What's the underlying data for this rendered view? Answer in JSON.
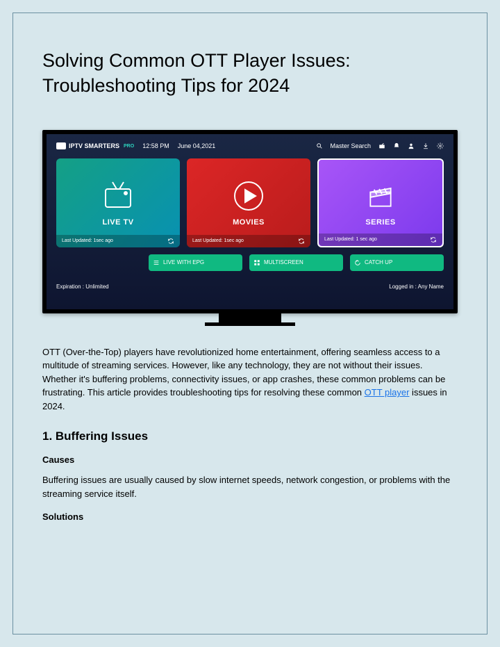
{
  "title": "Solving Common OTT Player Issues: Troubleshooting Tips for 2024",
  "tv": {
    "logo_main": "IPTV SMARTERS",
    "logo_sub": "PRO",
    "time": "12:58 PM",
    "date": "June 04,2021",
    "search_label": "Master Search",
    "tiles": {
      "livetv": {
        "label": "LIVE TV",
        "updated": "Last Updated: 1sec ago"
      },
      "movies": {
        "label": "MOVIES",
        "updated": "Last Updated: 1sec ago"
      },
      "series": {
        "label": "SERIES",
        "updated": "Last Updated: 1 sec ago"
      }
    },
    "buttons": {
      "live_epg": "LIVE WITH EPG",
      "multiscreen": "MULTISCREEN",
      "catchup": "CATCH UP"
    },
    "expiration": "Expiration : Unlimited",
    "logged_in": "Logged in : Any Name"
  },
  "intro": {
    "p1": "OTT (Over-the-Top) players have revolutionized home entertainment, offering seamless access to a multitude of streaming services. However, like any technology, they are not without their issues. Whether it's buffering problems, connectivity issues, or app crashes, these common problems can be frustrating. This article provides troubleshooting tips for resolving these common ",
    "link": "OTT player",
    "p2": " issues in 2024."
  },
  "section1": {
    "heading": "1. Buffering Issues",
    "causes_h": "Causes",
    "causes_p": "Buffering issues are usually caused by slow internet speeds, network congestion, or problems with the streaming service itself.",
    "solutions_h": "Solutions"
  }
}
